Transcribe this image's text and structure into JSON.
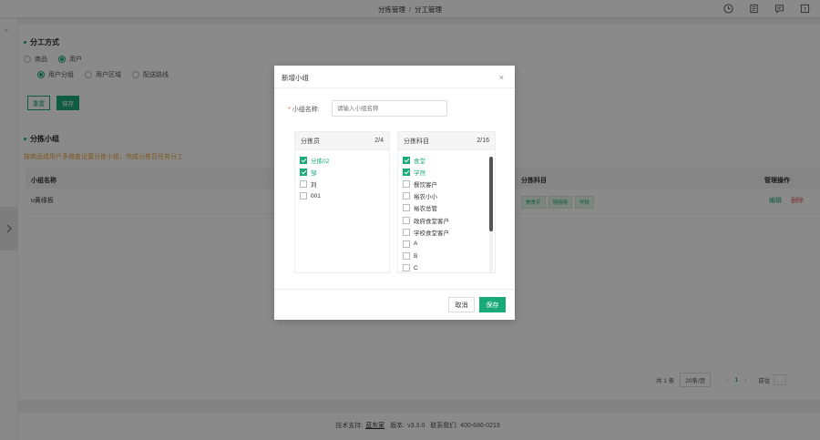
{
  "breadcrumb": {
    "parent": "分拣管理",
    "separator": "/",
    "current": "分工管理"
  },
  "icons": [
    "clock-icon",
    "document-icon",
    "chat-icon",
    "help-icon"
  ],
  "section1": {
    "title": "分工方式",
    "mode_options": [
      {
        "label": "商品",
        "selected": false
      },
      {
        "label": "用户",
        "selected": true
      }
    ],
    "sub_options": [
      {
        "label": "用户分组",
        "selected": true
      },
      {
        "label": "用户区域",
        "selected": false
      },
      {
        "label": "配送路线",
        "selected": false
      }
    ],
    "reset_label": "重置",
    "save_label": "保存"
  },
  "section2": {
    "title": "分拣小组",
    "hint": "按商品或用户多维度设置分拣小组，完成分拣员任务分工"
  },
  "table": {
    "columns": {
      "name": "小组名称",
      "subjects": "分拣科目",
      "ops": "管理操作"
    },
    "rows": [
      {
        "name": "u黄缘板",
        "tags": [
          "美食平",
          "嘻嘻嘻",
          "学校"
        ],
        "edit": "编辑",
        "delete": "删除"
      }
    ]
  },
  "pagination": {
    "total": "共 1 条",
    "page_size": "20条/页",
    "prev": "‹",
    "current": "1",
    "next": "›",
    "jump_label": "前往"
  },
  "footer": {
    "support_label": "技术支持:",
    "company": "蓝东家",
    "version_label": "版本:",
    "version": "v3.3.0",
    "contact_label": "联系我们:",
    "phone": "400-686-0219"
  },
  "modal": {
    "title": "新增小组",
    "close": "×",
    "name_label": "小组名称:",
    "name_required": "*",
    "name_placeholder": "请输入小组名称",
    "left_panel": {
      "title": "分拣员",
      "count": "2/4",
      "items": [
        {
          "label": "分拣02",
          "checked": true
        },
        {
          "label": "邹",
          "checked": true
        },
        {
          "label": "刘",
          "checked": false
        },
        {
          "label": "001",
          "checked": false
        }
      ]
    },
    "right_panel": {
      "title": "分拣科目",
      "count": "2/16",
      "items": [
        {
          "label": "食堂",
          "checked": true
        },
        {
          "label": "学然",
          "checked": true
        },
        {
          "label": "餐饮客户",
          "checked": false
        },
        {
          "label": "裕农小小",
          "checked": false
        },
        {
          "label": "裕农总管",
          "checked": false
        },
        {
          "label": "政府食堂客户",
          "checked": false
        },
        {
          "label": "学校食堂客户",
          "checked": false
        },
        {
          "label": "A",
          "checked": false
        },
        {
          "label": "B",
          "checked": false
        },
        {
          "label": "C",
          "checked": false
        }
      ]
    },
    "cancel_label": "取消",
    "save_label": "保存"
  },
  "colors": {
    "accent": "#1aaa7a",
    "danger": "#e45c5c",
    "warning": "#e6a23c"
  }
}
